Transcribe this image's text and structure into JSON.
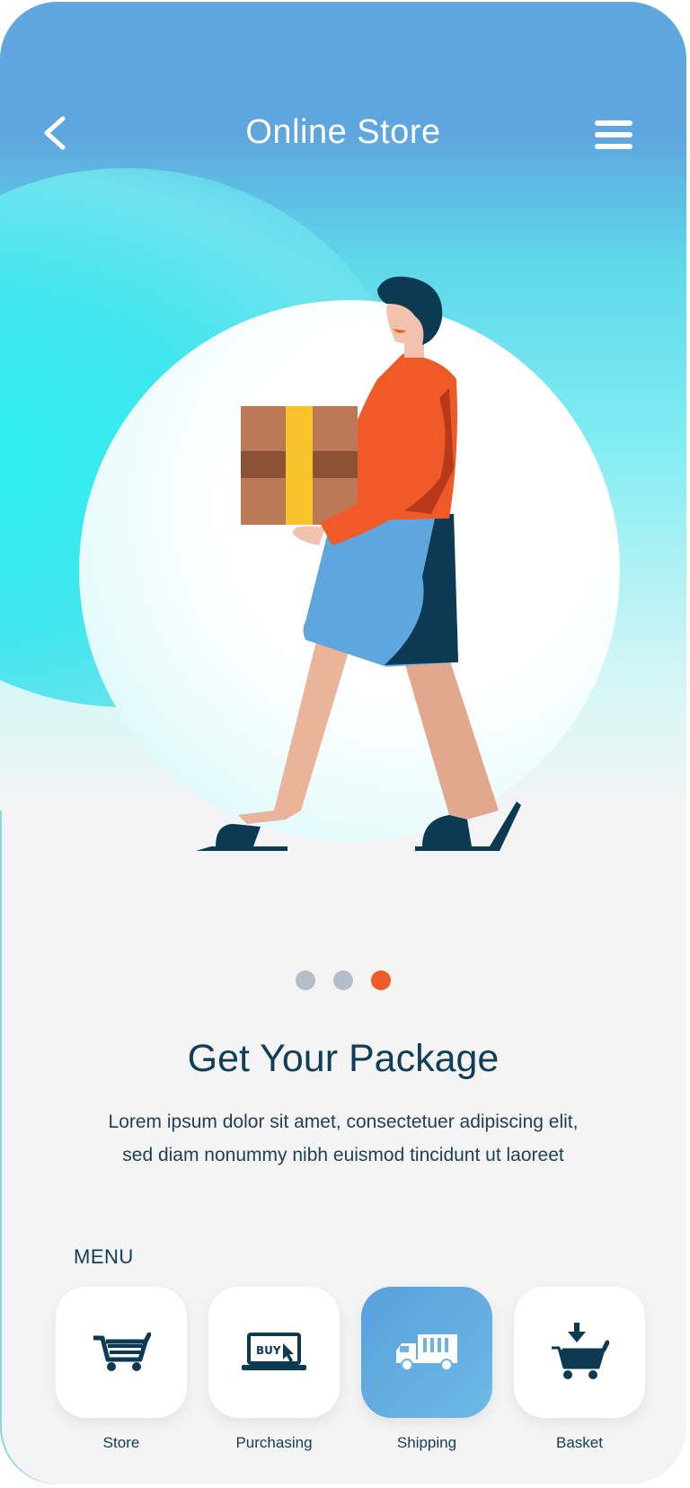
{
  "header": {
    "title": "Online Store",
    "back_icon": "chevron-left-icon",
    "menu_icon": "hamburger-menu-icon"
  },
  "carousel": {
    "dots": [
      {
        "active": false,
        "color": "#b4bec6"
      },
      {
        "active": false,
        "color": "#b4bec6"
      },
      {
        "active": true,
        "color": "#f05a28"
      }
    ]
  },
  "onboarding": {
    "heading": "Get Your Package",
    "description_line1": "Lorem ipsum dolor sit amet, consectetuer adipiscing elit,",
    "description_line2": "sed diam nonummy nibh euismod tincidunt ut laoreet"
  },
  "menu": {
    "label": "MENU",
    "items": [
      {
        "label": "Store",
        "icon": "shopping-cart-icon",
        "active": false
      },
      {
        "label": "Purchasing",
        "icon": "laptop-buy-icon",
        "active": false
      },
      {
        "label": "Shipping",
        "icon": "delivery-truck-icon",
        "active": true
      },
      {
        "label": "Basket",
        "icon": "cart-add-icon",
        "active": false
      }
    ],
    "buy_text": "BUY"
  },
  "colors": {
    "accent_blue": "#5fa6de",
    "navy": "#103d58",
    "orange": "#f05a28",
    "cyan": "#2ef1f0"
  }
}
